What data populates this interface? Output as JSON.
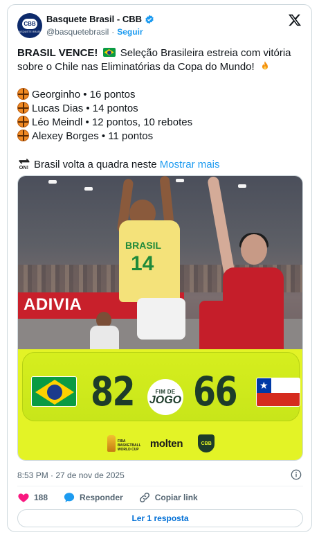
{
  "author": {
    "display_name": "Basquete Brasil - CBB",
    "handle": "@basquetebrasil",
    "separator": "·",
    "follow_label": "Seguir",
    "avatar_text": "CBB",
    "avatar_subtext": "BASQUETE BRASIL"
  },
  "tweet": {
    "headline_bold": "BRASIL VENCE!",
    "headline_rest_1": "Seleção Brasileira estreia com vitória",
    "headline_rest_2": "sobre o Chile nas Eliminatórias da Copa do Mundo!",
    "stats": [
      "Georginho • 16 pontos",
      "Lucas Dias • 14 pontos",
      "Léo Meindl • 12 pontos, 10 rebotes",
      "Alexey Borges • 11 pontos"
    ],
    "next_text": "Brasil volta a quadra neste",
    "show_more": "Mostrar mais"
  },
  "media": {
    "banner_text": "ADIVIA",
    "jersey_text": "BRASIL",
    "jersey_number": "14",
    "score_home": "82",
    "score_away": "66",
    "final_top": "FIM DE",
    "final_bottom": "JOGO",
    "sponsor_trophy_text": "FIBA BASKETBALL WORLD CUP",
    "sponsor_molten": "molten",
    "sponsor_cbb": "CBB"
  },
  "meta": {
    "timestamp": "8:53 PM · 27 de nov de 2025"
  },
  "actions": {
    "likes": "188",
    "reply_label": "Responder",
    "copy_link_label": "Copiar link"
  },
  "read_replies": "Ler 1 resposta",
  "colors": {
    "link": "#1d9bf0",
    "like": "#f91880",
    "scoreboard": "#e3f326",
    "text_secondary": "#536471"
  },
  "icons": [
    "verified-icon",
    "x-logo-icon",
    "brazil-flag-icon",
    "fire-icon",
    "basketball-icon",
    "on-arrow-icon",
    "info-icon",
    "heart-icon",
    "reply-bubble-icon",
    "link-icon"
  ]
}
